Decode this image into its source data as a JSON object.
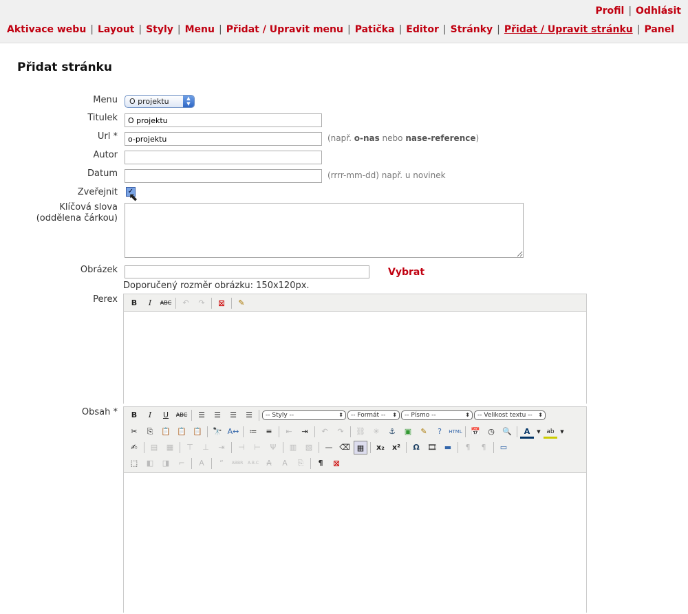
{
  "user_links": {
    "profile": "Profil",
    "logout": "Odhlásit"
  },
  "nav": [
    "Aktivace webu",
    "Layout",
    "Styly",
    "Menu",
    "Přidat / Upravit menu",
    "Patička",
    "Editor",
    "Stránky",
    "Přidat / Upravit stránku",
    "Panel"
  ],
  "page_title": "Přidat stránku",
  "form": {
    "menu_label": "Menu",
    "menu_value": "O projektu",
    "title_label": "Titulek",
    "title_value": "O projektu",
    "url_label": "Url *",
    "url_value": "o-projektu",
    "url_hint_prefix": "(např. ",
    "url_hint_ex1": "o-nas",
    "url_hint_mid": " nebo ",
    "url_hint_ex2": "nase-reference",
    "url_hint_suffix": ")",
    "author_label": "Autor",
    "author_value": "",
    "date_label": "Datum",
    "date_value": "",
    "date_hint": "(rrrr-mm-dd) např. u novinek",
    "publish_label": "Zveřejnit",
    "publish_checked": true,
    "keywords_label_1": "Klíčová slova",
    "keywords_label_2": "(oddělena čárkou)",
    "image_label": "Obrázek",
    "image_value": "",
    "image_select": "Vybrat",
    "image_hint": "Doporučený rozměr obrázku: 150x120px.",
    "perex_label": "Perex",
    "content_label": "Obsah *"
  },
  "editor_selects": [
    "-- Styly --",
    "-- Formát --",
    "-- Písmo --",
    "-- Velikost textu --"
  ]
}
